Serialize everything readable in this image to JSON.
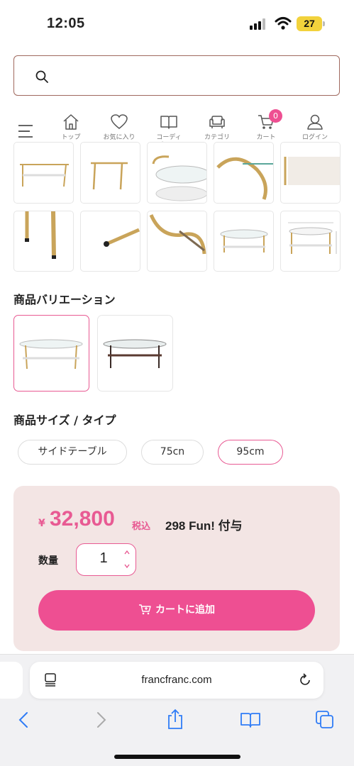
{
  "status_bar": {
    "time": "12:05",
    "battery": "27"
  },
  "search": {
    "placeholder": ""
  },
  "nav": {
    "items": [
      {
        "label": "トップ"
      },
      {
        "label": "お気に入り"
      },
      {
        "label": "コーディネート"
      },
      {
        "label": "カテゴリ"
      },
      {
        "label": "カート"
      },
      {
        "label": "ログイン"
      }
    ],
    "cart_count": "0"
  },
  "variation": {
    "title": "商品バリエーション"
  },
  "size": {
    "title": "商品サイズ / タイプ",
    "options": [
      "サイドテーブル",
      "75cn",
      "95cm"
    ]
  },
  "price": {
    "yen": "¥",
    "amount": "32,800",
    "tax_label": "税込",
    "fun_points": "298 Fun! 付与"
  },
  "quantity": {
    "label": "数量",
    "value": "1"
  },
  "add_to_cart": {
    "label": "カートに追加"
  },
  "browser": {
    "url": "francfranc.com"
  },
  "colors": {
    "accent": "#ee4f92",
    "card_bg": "#f3e5e4",
    "search_border": "#a0695e"
  }
}
